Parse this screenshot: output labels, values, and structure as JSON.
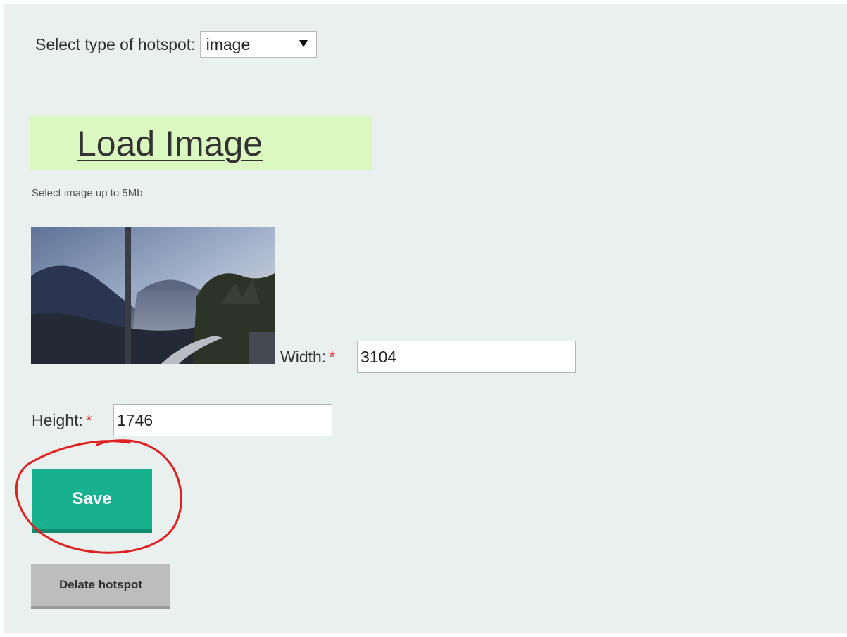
{
  "hotspot_type": {
    "label": "Select type of hotspot:",
    "selected": "image"
  },
  "load_image": {
    "label": "Load Image",
    "hint": "Select image up to 5Mb"
  },
  "preview": {
    "icon": "landscape-photo"
  },
  "fields": {
    "width_label": "Width:",
    "width_value": "3104",
    "height_label": "Height:",
    "height_value": "1746",
    "required_mark": "*"
  },
  "buttons": {
    "save_label": "Save",
    "delete_label": "Delate hotspot"
  },
  "colors": {
    "panel_bg": "#e9f0ed",
    "load_image_bg": "#dbf8c0",
    "save_bg": "#17b18e",
    "delete_bg": "#bdbdbd",
    "required": "#e53935",
    "annotation": "#e02020"
  }
}
